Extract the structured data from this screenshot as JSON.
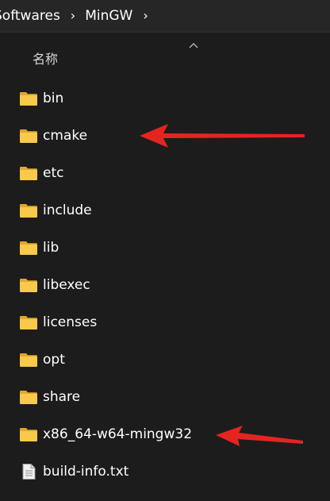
{
  "breadcrumb": {
    "parent": "Softwares",
    "current": "MinGW",
    "separator": "›",
    "trailing_separator": "›"
  },
  "columns": {
    "name_header": "名称",
    "sort_indicator": "sort-ascending-icon"
  },
  "items": [
    {
      "label": "bin",
      "type": "folder",
      "icon": "folder-icon"
    },
    {
      "label": "cmake",
      "type": "folder",
      "icon": "folder-icon"
    },
    {
      "label": "etc",
      "type": "folder",
      "icon": "folder-icon"
    },
    {
      "label": "include",
      "type": "folder",
      "icon": "folder-icon"
    },
    {
      "label": "lib",
      "type": "folder",
      "icon": "folder-icon"
    },
    {
      "label": "libexec",
      "type": "folder",
      "icon": "folder-icon"
    },
    {
      "label": "licenses",
      "type": "folder",
      "icon": "folder-icon"
    },
    {
      "label": "opt",
      "type": "folder",
      "icon": "folder-icon"
    },
    {
      "label": "share",
      "type": "folder",
      "icon": "folder-icon"
    },
    {
      "label": "x86_64-w64-mingw32",
      "type": "folder",
      "icon": "folder-icon"
    },
    {
      "label": "build-info.txt",
      "type": "file",
      "icon": "text-file-icon"
    }
  ],
  "annotations": {
    "arrow_color": "#e52420",
    "highlighted_items": [
      "cmake",
      "x86_64-w64-mingw32"
    ]
  },
  "colors": {
    "background": "#1c1c1c",
    "breadcrumb_bar": "#262626",
    "folder_yellow": "#f8c94a",
    "folder_back": "#e0a92a",
    "text": "#ffffff"
  }
}
